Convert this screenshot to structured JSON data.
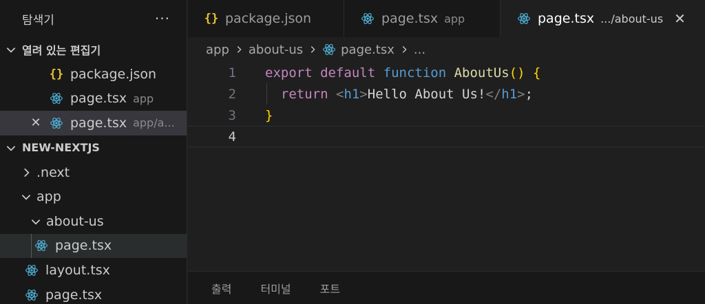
{
  "sidebar": {
    "title": "탐색기",
    "more": "···",
    "open_editors": {
      "header": "열려 있는 편집기",
      "items": [
        {
          "name": "package.json",
          "hint": ""
        },
        {
          "name": "page.tsx",
          "hint": "app"
        },
        {
          "name": "page.tsx",
          "hint": "app/a..."
        }
      ]
    },
    "project": {
      "header": "NEW-NEXTJS",
      "items": [
        {
          "name": ".next"
        },
        {
          "name": "app"
        },
        {
          "name": "about-us"
        },
        {
          "name": "page.tsx"
        },
        {
          "name": "layout.tsx"
        },
        {
          "name": "page.tsx"
        }
      ]
    }
  },
  "tabs": [
    {
      "name": "package.json",
      "hint": ""
    },
    {
      "name": "page.tsx",
      "hint": "app"
    },
    {
      "name": "page.tsx",
      "hint": ".../about-us",
      "close": "✕"
    }
  ],
  "breadcrumb": {
    "parts": [
      "app",
      "about-us",
      "page.tsx",
      "..."
    ]
  },
  "editor": {
    "line_numbers": [
      "1",
      "2",
      "3",
      "4"
    ],
    "line1": {
      "kw1": "export",
      "kw2": "default",
      "kw3": "function",
      "fn": "AboutUs",
      "parens": "()",
      "brace": "{"
    },
    "line2": {
      "kw": "return",
      "open_lt": "<",
      "tag1": "h1",
      "open_gt": ">",
      "text": "Hello About Us!",
      "close_lt": "</",
      "tag2": "h1",
      "close_gt": ">",
      "semi": ";"
    },
    "line3": {
      "brace": "}"
    }
  },
  "panel": {
    "tabs": [
      "출력",
      "터미널",
      "포트"
    ]
  },
  "colors": {
    "react_icon": "#4fb3d9",
    "json_icon": "#e8c233"
  }
}
